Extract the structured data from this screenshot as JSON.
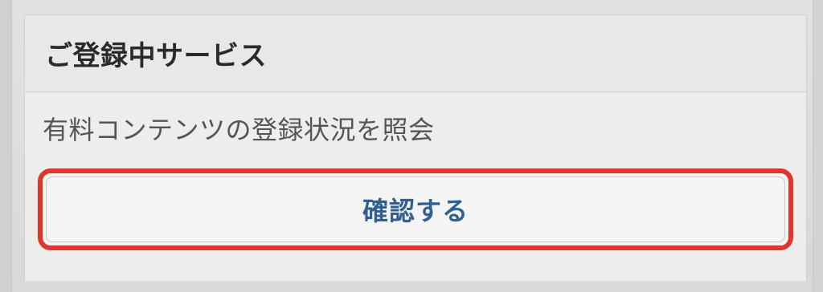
{
  "section": {
    "title": "ご登録中サービス",
    "description": "有料コンテンツの登録状況を照会",
    "confirm_button_label": "確認する"
  },
  "colors": {
    "highlight_border": "#e0352b",
    "button_text": "#2f5f94",
    "title_text": "#2a2a2a",
    "description_text": "#555555"
  }
}
